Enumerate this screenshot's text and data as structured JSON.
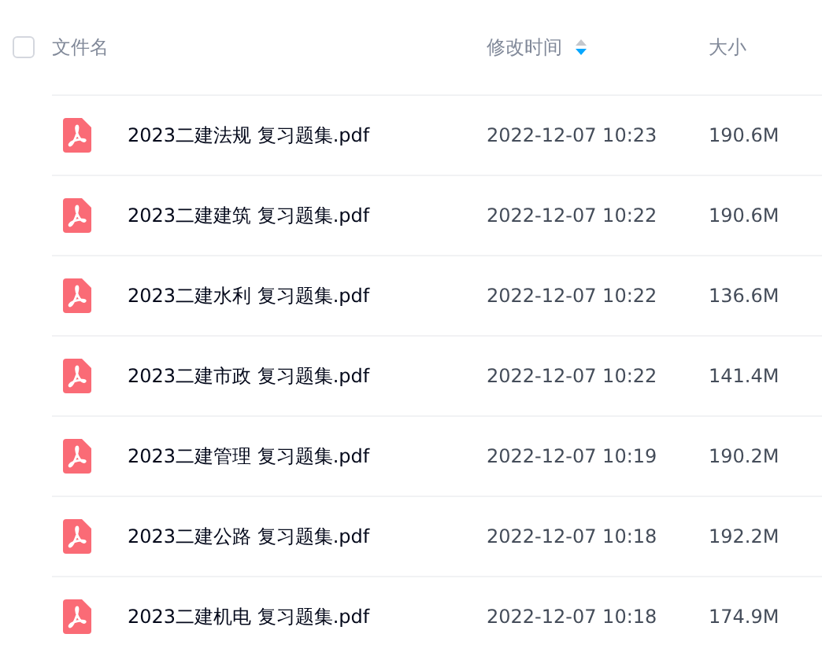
{
  "header": {
    "select_all": {
      "checked": false
    },
    "columns": [
      {
        "label": "文件名",
        "sorted": false
      },
      {
        "label": "修改时间",
        "sorted": true
      },
      {
        "label": "大小",
        "sorted": false
      }
    ]
  },
  "files": [
    {
      "name": "2023二建法规 复习题集.pdf",
      "modified": "2022-12-07 10:23",
      "size": "190.6M"
    },
    {
      "name": "2023二建建筑 复习题集.pdf",
      "modified": "2022-12-07 10:22",
      "size": "190.6M"
    },
    {
      "name": "2023二建水利 复习题集.pdf",
      "modified": "2022-12-07 10:22",
      "size": "136.6M"
    },
    {
      "name": "2023二建市政 复习题集.pdf",
      "modified": "2022-12-07 10:22",
      "size": "141.4M"
    },
    {
      "name": "2023二建管理 复习题集.pdf",
      "modified": "2022-12-07 10:19",
      "size": "190.2M"
    },
    {
      "name": "2023二建公路 复习题集.pdf",
      "modified": "2022-12-07 10:18",
      "size": "192.2M"
    },
    {
      "name": "2023二建机电 复习题集.pdf",
      "modified": "2022-12-07 10:18",
      "size": "174.9M"
    }
  ]
}
